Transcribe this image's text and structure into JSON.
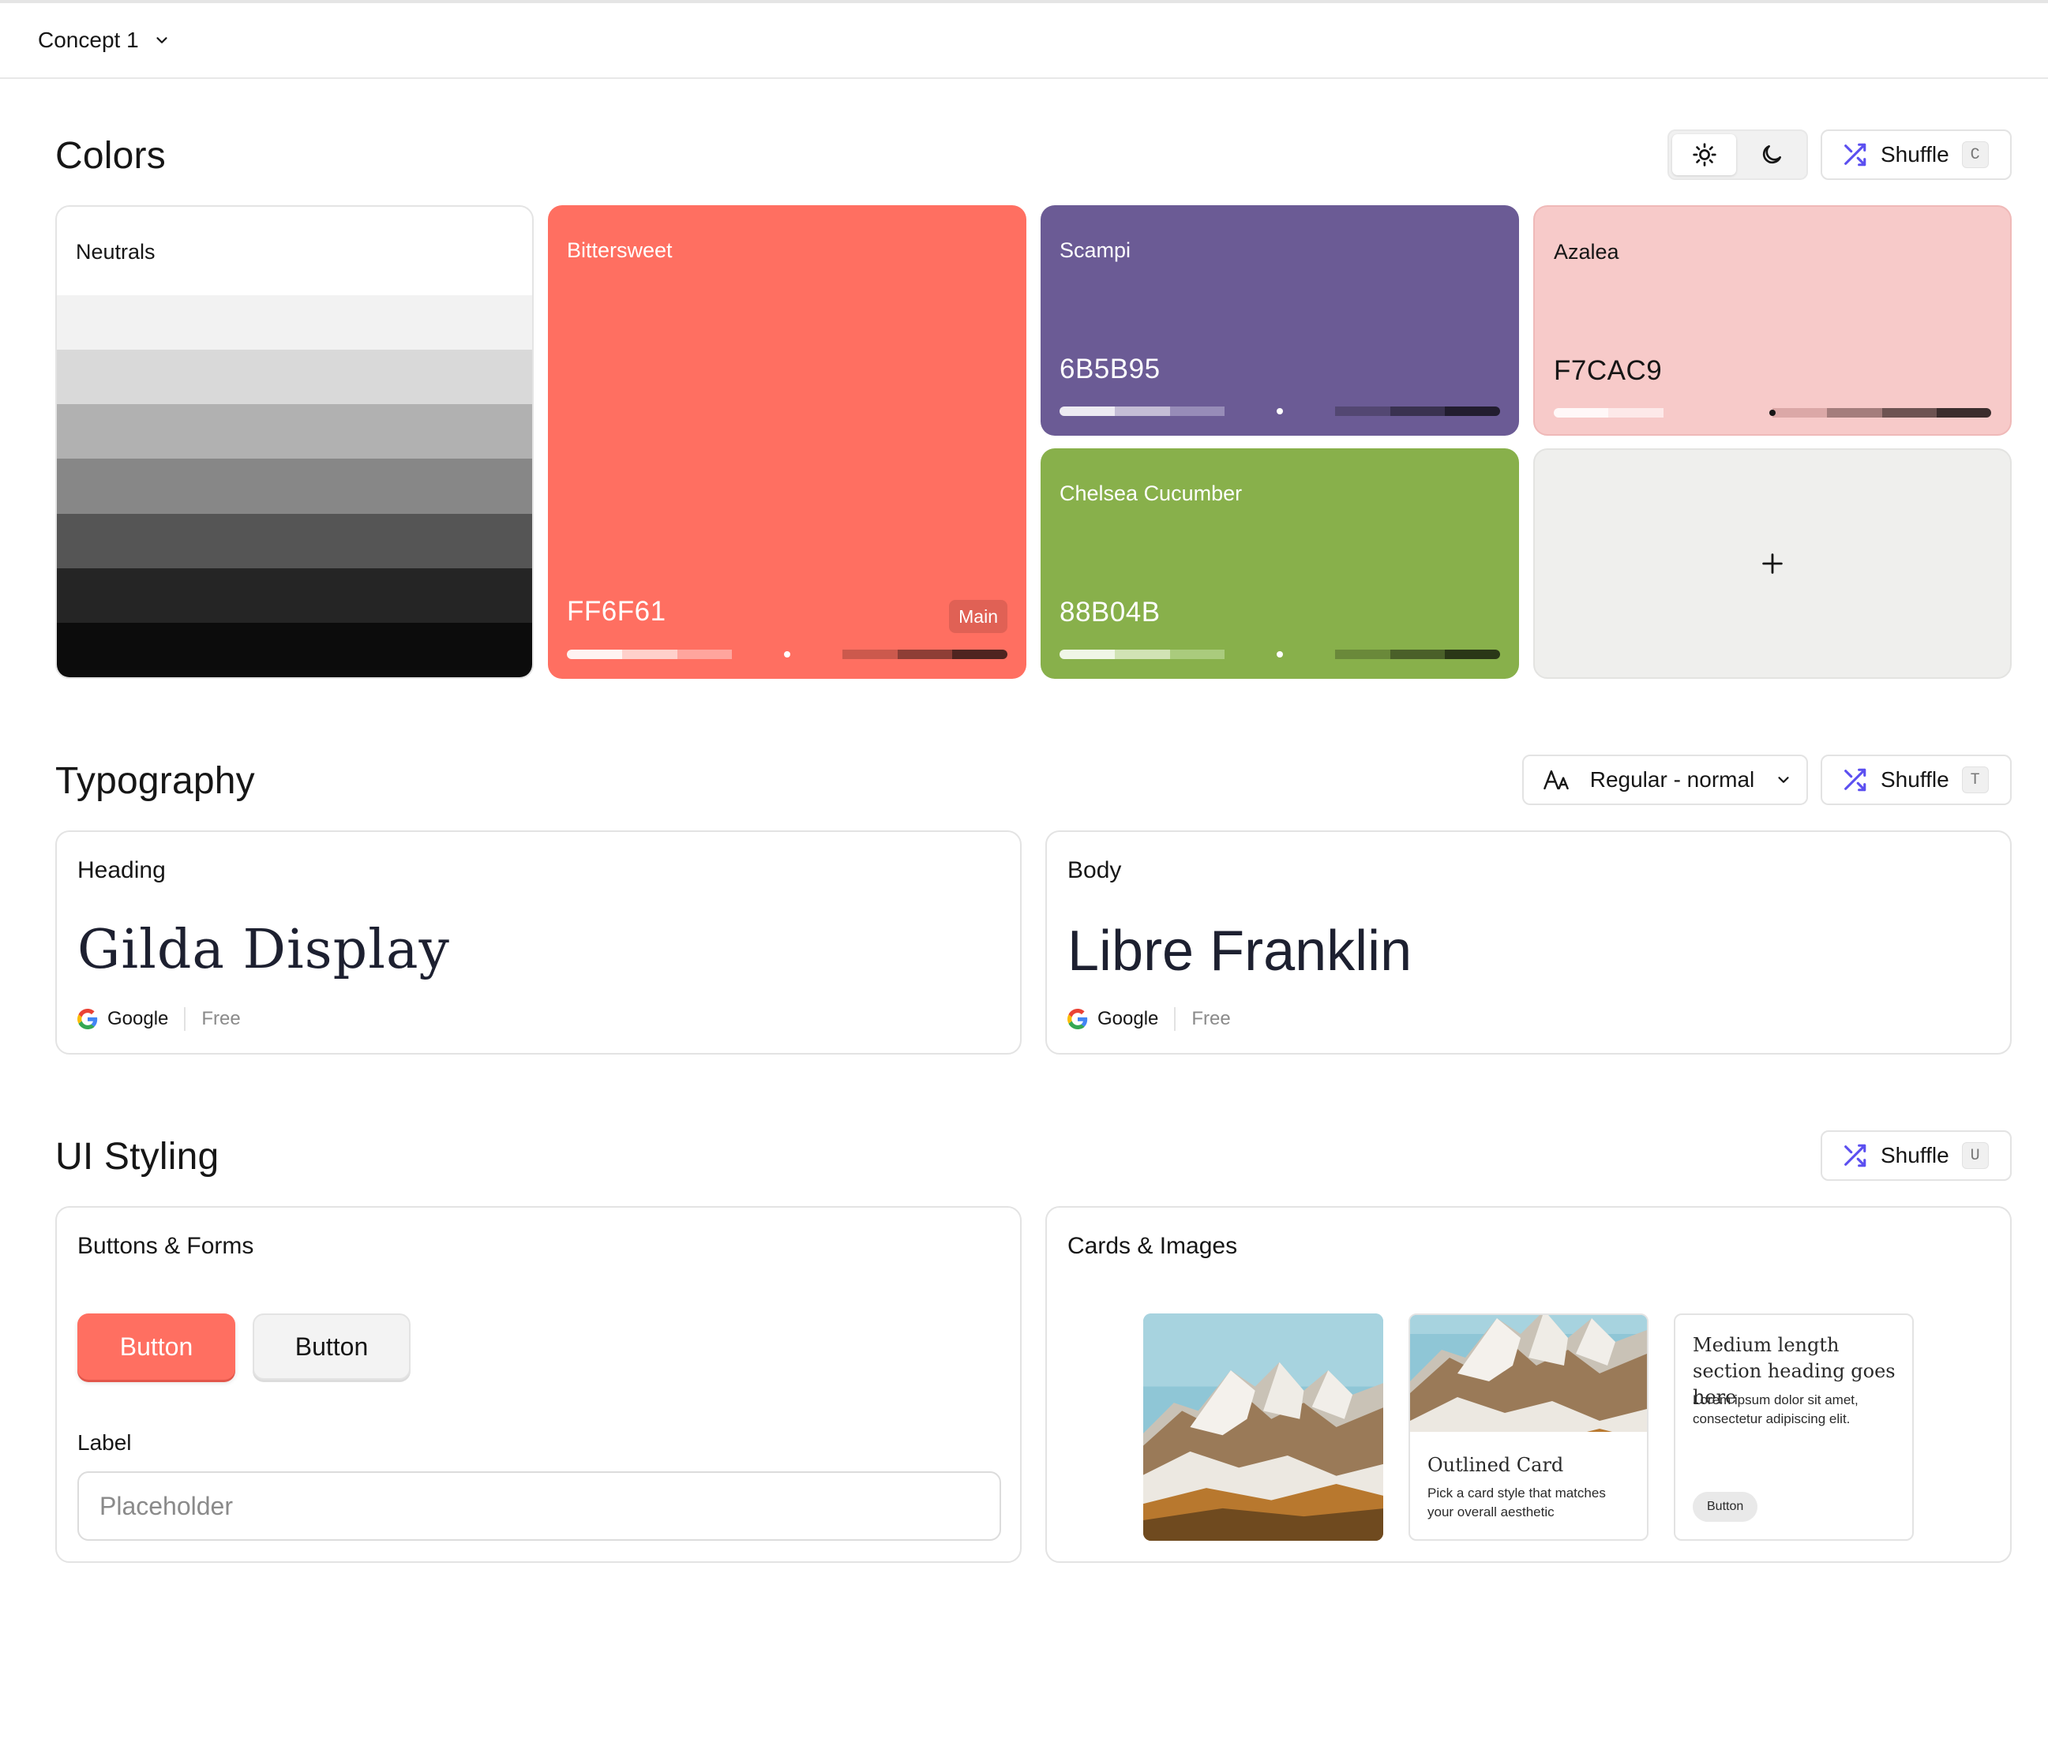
{
  "topbar": {
    "concept_label": "Concept 1"
  },
  "colors": {
    "title": "Colors",
    "shuffle_label": "Shuffle",
    "shuffle_key": "C",
    "theme": {
      "active": "light"
    },
    "neutrals": {
      "name": "Neutrals",
      "stripes": [
        "#f2f2f2",
        "#d9d9d9",
        "#b1b1b1",
        "#878787",
        "#555555",
        "#252525",
        "#0c0c0c"
      ]
    },
    "main": {
      "name": "Bittersweet",
      "hex": "FF6F61",
      "badge": "Main",
      "color": "#ff6f61",
      "scale": [
        "#fff3f1",
        "#ffd0cb",
        "#ffa59d",
        "#ff6f61",
        "#ff6f61",
        "#cc594d",
        "#8e3e36",
        "#4f2420"
      ]
    },
    "swatches": [
      {
        "name": "Scampi",
        "hex": "6B5B95",
        "color": "#6b5b95",
        "scale": [
          "#eceaf2",
          "#c4bdd6",
          "#978cb8",
          "#6b5b95",
          "#6b5b95",
          "#534772",
          "#3a3250",
          "#221d2f"
        ]
      },
      {
        "name": "Azalea",
        "hex": "F7CAC9",
        "color": "#f7cac9",
        "scale": [
          "#fff8f8",
          "#fde9e9",
          "#f7cac9",
          "#f7cac9",
          "#dba8a7",
          "#a47d7c",
          "#6d5352",
          "#3b2d2d"
        ]
      },
      {
        "name": "Chelsea Cucumber",
        "hex": "88B04B",
        "color": "#88b04b",
        "scale": [
          "#f0f6e7",
          "#d1e3b5",
          "#aacb7d",
          "#88b04b",
          "#88b04b",
          "#6a893a",
          "#4a6029",
          "#2a3717"
        ]
      }
    ]
  },
  "typography": {
    "title": "Typography",
    "font_select_label": "Regular - normal",
    "shuffle_label": "Shuffle",
    "shuffle_key": "T",
    "heading": {
      "label": "Heading",
      "font": "Gilda Display",
      "provider": "Google",
      "license": "Free"
    },
    "body": {
      "label": "Body",
      "font": "Libre Franklin",
      "provider": "Google",
      "license": "Free"
    }
  },
  "ui_styling": {
    "title": "UI Styling",
    "shuffle_label": "Shuffle",
    "shuffle_key": "U",
    "buttons_forms": {
      "title": "Buttons & Forms",
      "primary_button": "Button",
      "secondary_button": "Button",
      "field_label": "Label",
      "field_placeholder": "Placeholder"
    },
    "cards_images": {
      "title": "Cards & Images",
      "outlined_card": {
        "title": "Outlined Card",
        "text": "Pick a card style that matches your overall aesthetic"
      },
      "text_card": {
        "title": "Medium length section heading goes here",
        "text": "Lorem ipsum dolor sit amet, consectetur adipiscing elit.",
        "button": "Button"
      }
    }
  },
  "icons": [
    "chevron-down-icon",
    "sun-icon",
    "moon-icon",
    "shuffle-icon",
    "plus-icon",
    "font-icon",
    "google-icon"
  ]
}
